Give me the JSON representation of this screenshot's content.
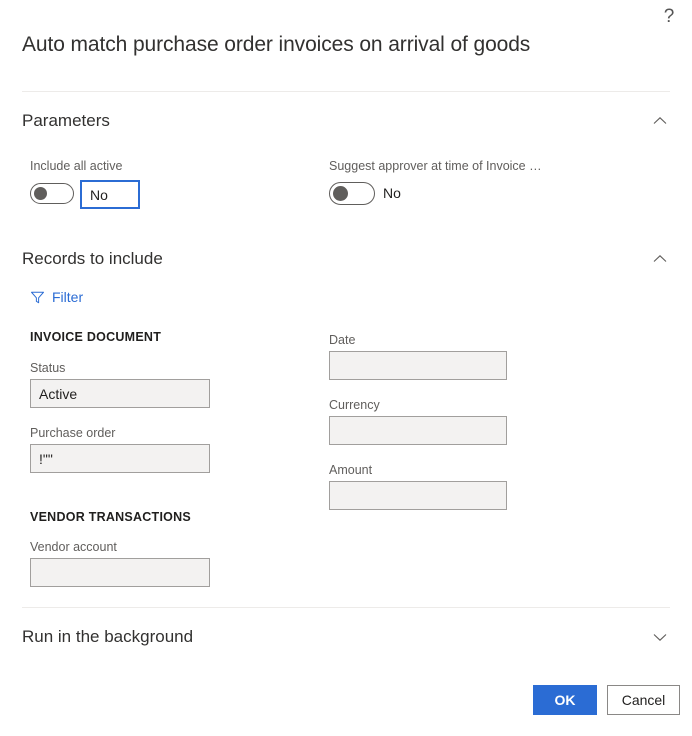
{
  "dialog": {
    "title": "Auto match purchase order invoices on arrival of goods",
    "help_icon_label": "?"
  },
  "sections": {
    "parameters": {
      "title": "Parameters",
      "chevron": "chevron-up",
      "fields": {
        "include_all_active": {
          "label": "Include all active",
          "toggle_state": "off",
          "value": "No"
        },
        "suggest_approver": {
          "label": "Suggest approver at time of Invoice …",
          "toggle_state": "off",
          "value": "No"
        }
      }
    },
    "records_to_include": {
      "title": "Records to include",
      "chevron": "chevron-up",
      "filter_button": {
        "label": "Filter",
        "icon": "filter-funnel-icon"
      },
      "groups": [
        {
          "heading": "INVOICE DOCUMENT",
          "fields": [
            {
              "label": "Status",
              "value": "Active",
              "placeholder": ""
            },
            {
              "label": "Purchase order",
              "value": "!\"\"",
              "placeholder": ""
            },
            {
              "label": "Date",
              "value": "",
              "placeholder": ""
            },
            {
              "label": "Currency",
              "value": "",
              "placeholder": ""
            },
            {
              "label": "Amount",
              "value": "",
              "placeholder": ""
            }
          ]
        },
        {
          "heading": "VENDOR TRANSACTIONS",
          "fields": [
            {
              "label": "Vendor account",
              "value": "",
              "placeholder": ""
            }
          ]
        }
      ]
    },
    "run_in_background": {
      "title": "Run in the background",
      "chevron": "chevron-down"
    }
  },
  "footer": {
    "ok_label": "OK",
    "cancel_label": "Cancel"
  },
  "colors": {
    "accent": "#2b6cd4",
    "field_bg": "#f3f2f1",
    "field_border": "#a19f9d",
    "divider": "#edebe9",
    "text": "#201f1e",
    "label": "#605e5c"
  }
}
